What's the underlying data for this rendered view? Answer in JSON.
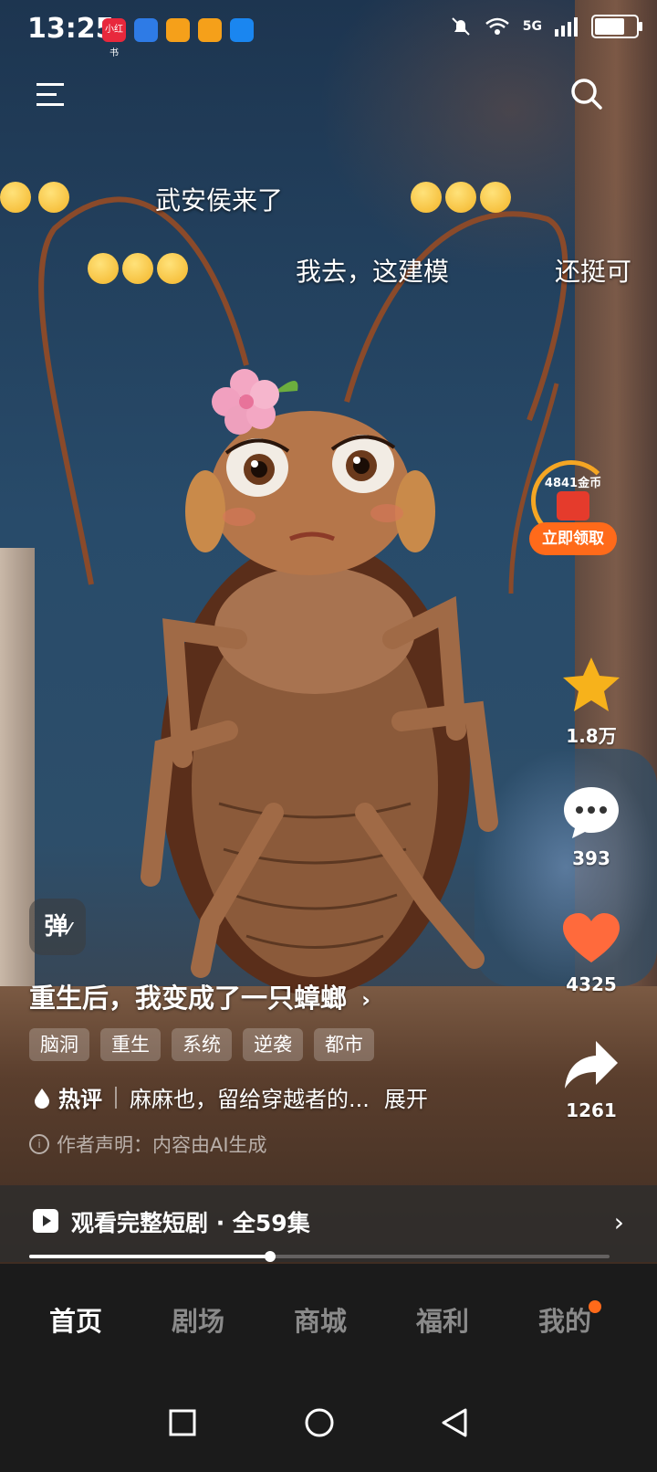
{
  "status_bar": {
    "time": "13:25",
    "apps": [
      {
        "name": "xiaohongshu-icon",
        "text": "小红书",
        "color": "#e8283c"
      },
      {
        "name": "app-icon",
        "text": "",
        "color": "#2e7be6"
      },
      {
        "name": "weibo-icon",
        "text": "",
        "color": "#f5a01a"
      },
      {
        "name": "weibo-icon",
        "text": "",
        "color": "#f5a01a"
      },
      {
        "name": "weather-icon",
        "text": "",
        "color": "#1a86f0"
      }
    ],
    "network": "5G",
    "battery_level": 0.8
  },
  "danmaku": [
    {
      "text": "武安侯来了"
    },
    {
      "text": "我去，这建模"
    },
    {
      "text": "还挺可"
    }
  ],
  "coin_widget": {
    "coins": "4841金币",
    "button": "立即领取"
  },
  "side_actions": {
    "collect_count": "1.8万",
    "comment_count": "393",
    "like_count": "4325",
    "share_count": "1261"
  },
  "danmu_toggle": "弹",
  "drama": {
    "title": "重生后，我变成了一只蟑螂",
    "tags": [
      "脑洞",
      "重生",
      "系统",
      "逆袭",
      "都市"
    ],
    "hot_label": "热评",
    "hot_comment": "麻麻也，留给穿越者的...",
    "expand": "展开",
    "notice": "作者声明：内容由AI生成",
    "watch_full": "观看完整短剧 · 全59集",
    "progress": 0.415
  },
  "tabs": [
    {
      "label": "首页",
      "active": true
    },
    {
      "label": "剧场",
      "active": false
    },
    {
      "label": "商城",
      "active": false
    },
    {
      "label": "福利",
      "active": false
    },
    {
      "label": "我的",
      "active": false
    }
  ],
  "colors": {
    "accent": "#ff6a1a",
    "star": "#f7b21b",
    "heart": "#ff6a3c"
  }
}
